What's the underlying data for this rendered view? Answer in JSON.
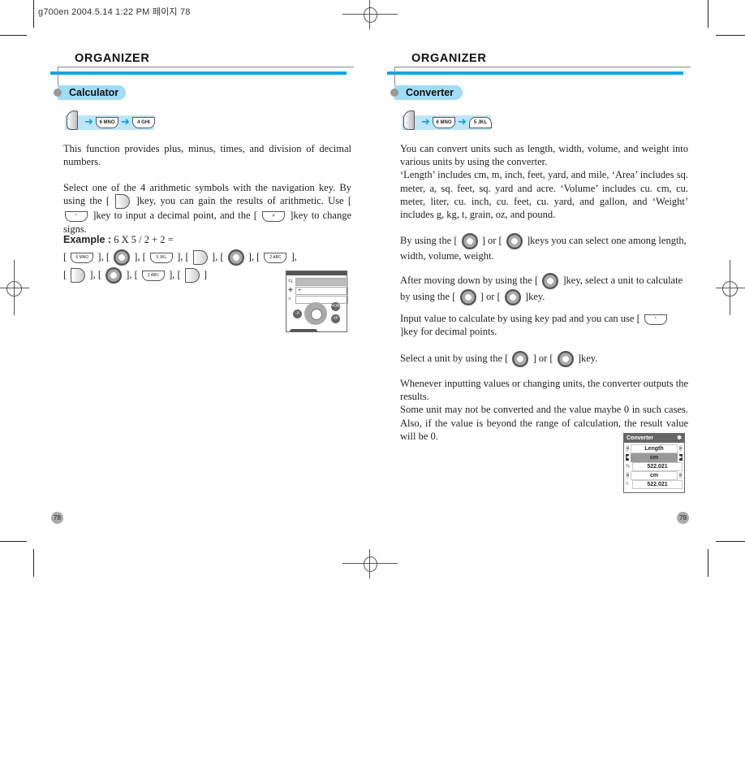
{
  "print_header": "g700en  2004.5.14 1:22 PM 페이지 78",
  "left_page": {
    "section": "ORGANIZER",
    "topic": "Calculator",
    "key_path": [
      "MENU",
      "6 MNO",
      "4 GHI"
    ],
    "para1": "This function provides plus, minus, times, and division of decimal numbers.",
    "para2_parts": [
      "Select one of the 4 arithmetic symbols with the navigation key. By using the [",
      "]key, you can gain the results of arithmetic. Use [",
      "]key to input a decimal point, and the [",
      "]key to change signs."
    ],
    "example_label": "Example :",
    "example_expr": "6 X 5 / 2 + 2 =",
    "example_keys_row1": [
      "6 MNO",
      "nav-left",
      "5 JKL",
      "OK",
      "nav-right",
      "2 ABC"
    ],
    "example_keys_row2": [
      "OK",
      "nav-up",
      "2 ABC",
      "OK"
    ],
    "page_number": "78",
    "calc_screen": {
      "row1": "",
      "row2": "+",
      "row3": "",
      "buttons": [
        "-X",
        "×",
        "÷",
        "+",
        "-",
        "=OK",
        "±#"
      ]
    }
  },
  "right_page": {
    "section": "ORGANIZER",
    "topic": "Converter",
    "key_path": [
      "MENU",
      "6 MNO",
      "5 JKL"
    ],
    "para1": "You can convert units such as length, width, volume, and weight into various units by using the converter.",
    "para2": "‘Length’ includes cm, m, inch, feet, yard, and mile, ‘Area’ includes sq. meter, a, sq. feet, sq. yard and acre. ‘Volume’ includes cu. cm, cu. meter, liter, cu. inch, cu. feet, cu. yard, and gallon, and ‘Weight’ includes g, kg, t, grain, oz, and pound.",
    "para3_parts": [
      "By using the [",
      "] or [",
      "]keys you can select one among length, width, volume, weight."
    ],
    "para4_parts": [
      "After moving down by using the [",
      "]key, select a unit to calculate by using the [",
      "] or [",
      "]key."
    ],
    "para5_parts": [
      "Input value to calculate by using key pad and you can use [",
      "]key for decimal points."
    ],
    "para6_parts": [
      "Select a unit by using the [",
      "] or [",
      "]key."
    ],
    "para7": "Whenever inputting values or changing units, the converter outputs the results.",
    "para8": "Some unit may not be converted and the value maybe 0 in such cases. Also, if the value is beyond the range of calculation, the result value will be 0.",
    "page_number": "79",
    "converter_screen": {
      "title": "Converter",
      "title_icon": "✱",
      "category": "Length",
      "unit_from": "cm",
      "value_from": "522.021",
      "unit_to": "cm",
      "value_to": "522.021"
    }
  }
}
